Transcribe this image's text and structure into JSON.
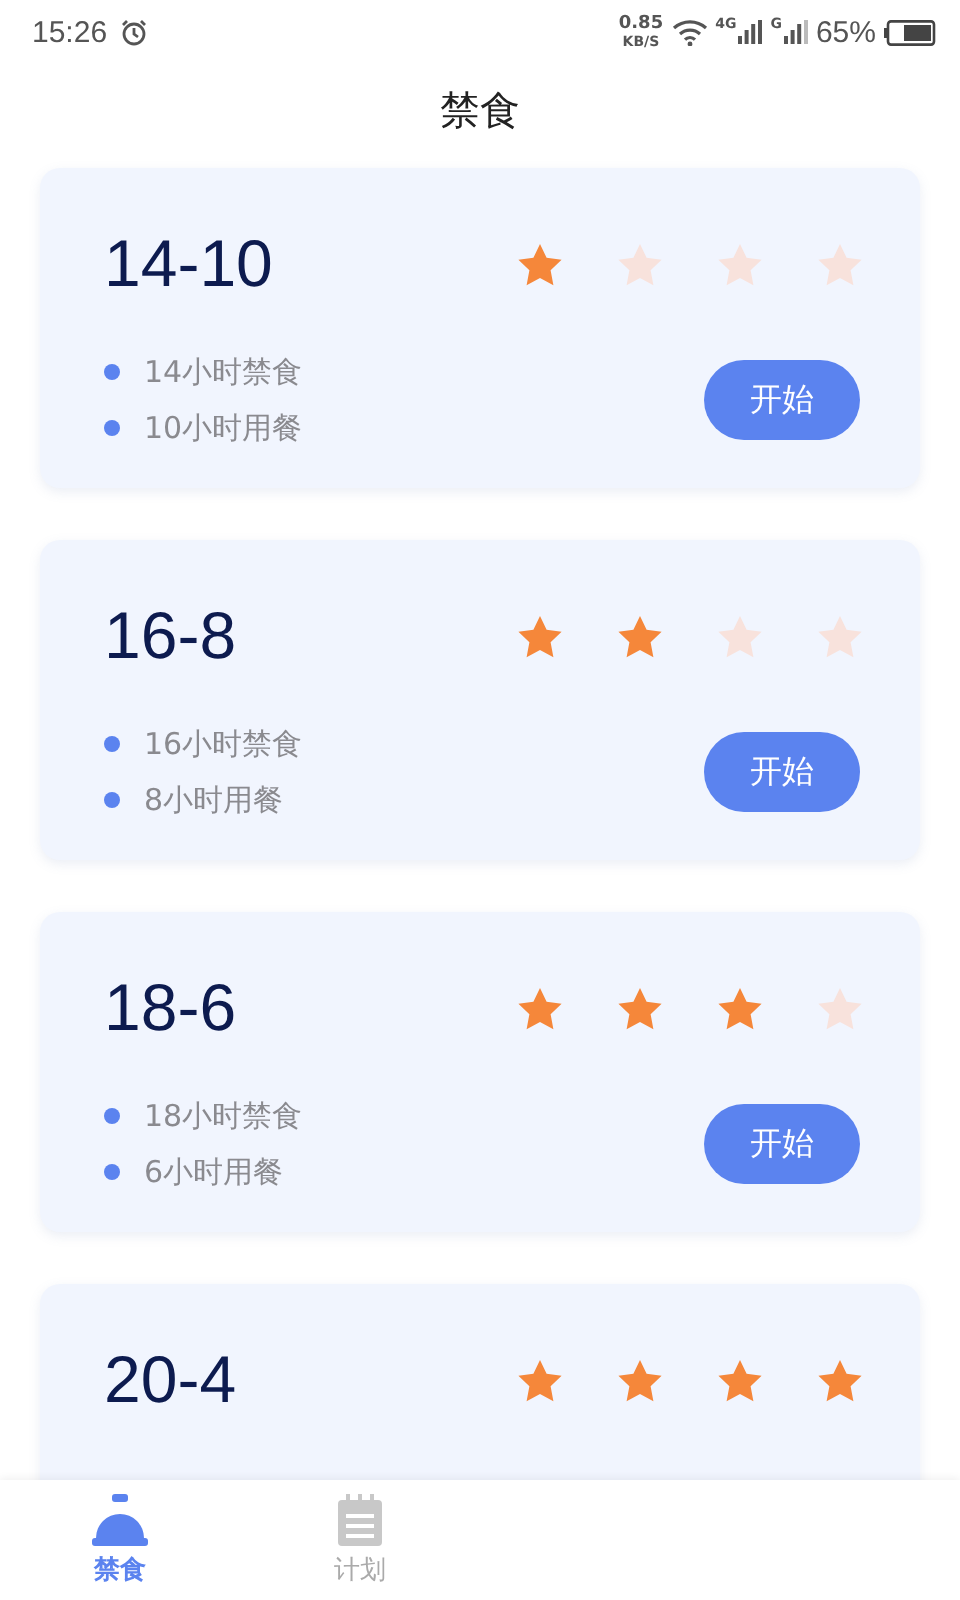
{
  "status_bar": {
    "time": "15:26",
    "net_speed": "0.85",
    "net_unit": "KB/S",
    "net_4g": "4G",
    "net_g": "G",
    "battery": "65%"
  },
  "title": "禁食",
  "plans": [
    {
      "name": "14-10",
      "stars": 1,
      "items": [
        "14小时禁食",
        "10小时用餐"
      ],
      "button": "开始"
    },
    {
      "name": "16-8",
      "stars": 2,
      "items": [
        "16小时禁食",
        "8小时用餐"
      ],
      "button": "开始"
    },
    {
      "name": "18-6",
      "stars": 3,
      "items": [
        "18小时禁食",
        "6小时用餐"
      ],
      "button": "开始"
    },
    {
      "name": "20-4",
      "stars": 4
    }
  ],
  "tabs": [
    {
      "label": "禁食",
      "kind": "fasting",
      "selected": true
    },
    {
      "label": "计划",
      "kind": "plan",
      "selected": false
    }
  ]
}
